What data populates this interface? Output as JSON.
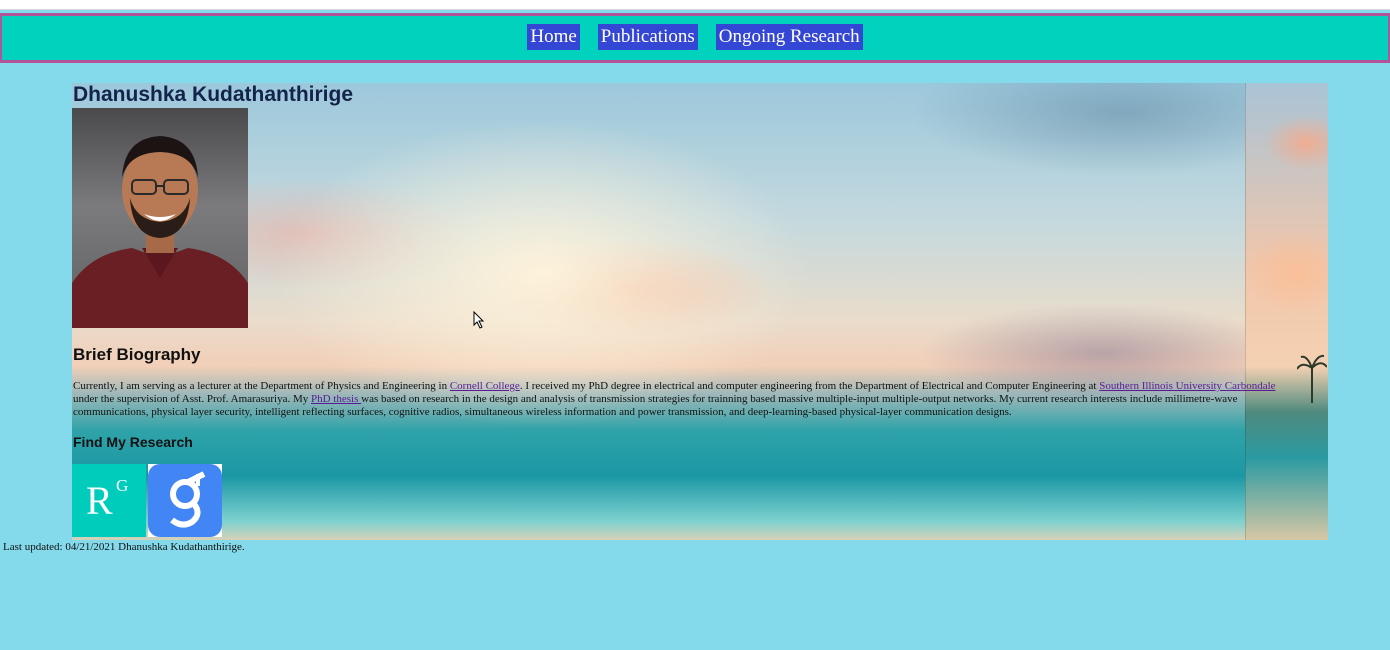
{
  "nav": {
    "items": [
      {
        "label": "Home"
      },
      {
        "label": "Publications"
      },
      {
        "label": "Ongoing Research"
      }
    ]
  },
  "header": {
    "title": "Dhanushka Kudathanthirige"
  },
  "biography": {
    "heading": "Brief Biography",
    "text_1": "Currently, I am serving as a lecturer at the Department of Physics and Engineering in ",
    "link_college": "Cornell College",
    "text_2": ". I received my PhD degree in electrical and computer engineering from the Department of Electrical and Computer Engineering at ",
    "link_university": "Southern Illinois University Carbondale",
    "text_3": " under the supervision of Asst. Prof. Amarasuriya. My ",
    "link_thesis": "PhD thesis ",
    "text_4": "was based on research in the design and analysis of transmission strategies for trainning based massive multiple-input multiple-output networks. My current research interests include millimetre-wave communications, physical layer security, intelligent reflecting surfaces, cognitive radios, simultaneous wireless information and power transmission, and deep-learning-based physical-layer communication designs."
  },
  "research": {
    "heading": "Find My Research",
    "researchgate_icon": "researchgate-icon",
    "researchgate_letters": {
      "main": "R",
      "sup": "G"
    },
    "scholar_icon": "google-scholar-icon"
  },
  "footer": {
    "text": "Last updated: 04/21/2021 Dhanushka Kudathanthirige."
  },
  "colors": {
    "page_background": "#84d9ea",
    "navbar": "#00d2be",
    "navbar_border": "#b0559a",
    "nav_button": "#3446d4",
    "link": "#5a1c96",
    "researchgate": "#00ccbb",
    "scholar": "#4285f4"
  }
}
